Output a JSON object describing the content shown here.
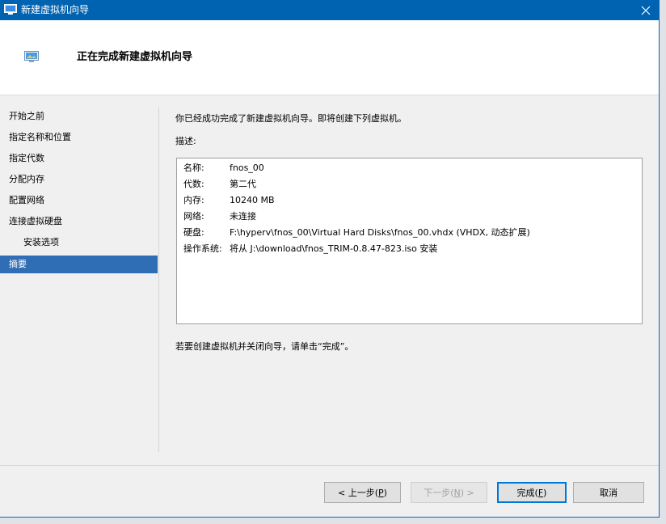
{
  "window": {
    "title": "新建虚拟机向导",
    "icon": "vm-wizard-icon",
    "close_icon": "close-icon"
  },
  "header": {
    "title": "正在完成新建虚拟机向导",
    "icon": "vm-monitor-icon"
  },
  "sidebar": {
    "items": [
      {
        "label": "开始之前"
      },
      {
        "label": "指定名称和位置"
      },
      {
        "label": "指定代数"
      },
      {
        "label": "分配内存"
      },
      {
        "label": "配置网络"
      },
      {
        "label": "连接虚拟硬盘"
      },
      {
        "label": "安装选项"
      },
      {
        "label": "摘要"
      }
    ],
    "active_index": 7
  },
  "content": {
    "intro": "你已经成功完成了新建虚拟机向导。即将创建下列虚拟机。",
    "description_label": "描述:",
    "summary": [
      {
        "key": "名称:",
        "value": "fnos_00"
      },
      {
        "key": "代数:",
        "value": "第二代"
      },
      {
        "key": "内存:",
        "value": "10240 MB"
      },
      {
        "key": "网络:",
        "value": "未连接"
      },
      {
        "key": "硬盘:",
        "value": "F:\\hyperv\\fnos_00\\Virtual Hard Disks\\fnos_00.vhdx (VHDX, 动态扩展)"
      },
      {
        "key": "操作系统:",
        "value": "将从 J:\\download\\fnos_TRIM-0.8.47-823.iso 安装"
      }
    ],
    "finish_note": "若要创建虚拟机并关闭向导，请单击“完成”。"
  },
  "buttons": {
    "prev": {
      "text": "< 上一步(",
      "key": "P",
      "end": ")"
    },
    "next": {
      "text": "下一步(",
      "key": "N",
      "end": ") >"
    },
    "finish": {
      "text": "完成(",
      "key": "F",
      "end": ")"
    },
    "cancel": "取消"
  },
  "colors": {
    "titlebar": "#0063b1",
    "selection": "#2f6db5",
    "default_button_border": "#0078d7"
  }
}
